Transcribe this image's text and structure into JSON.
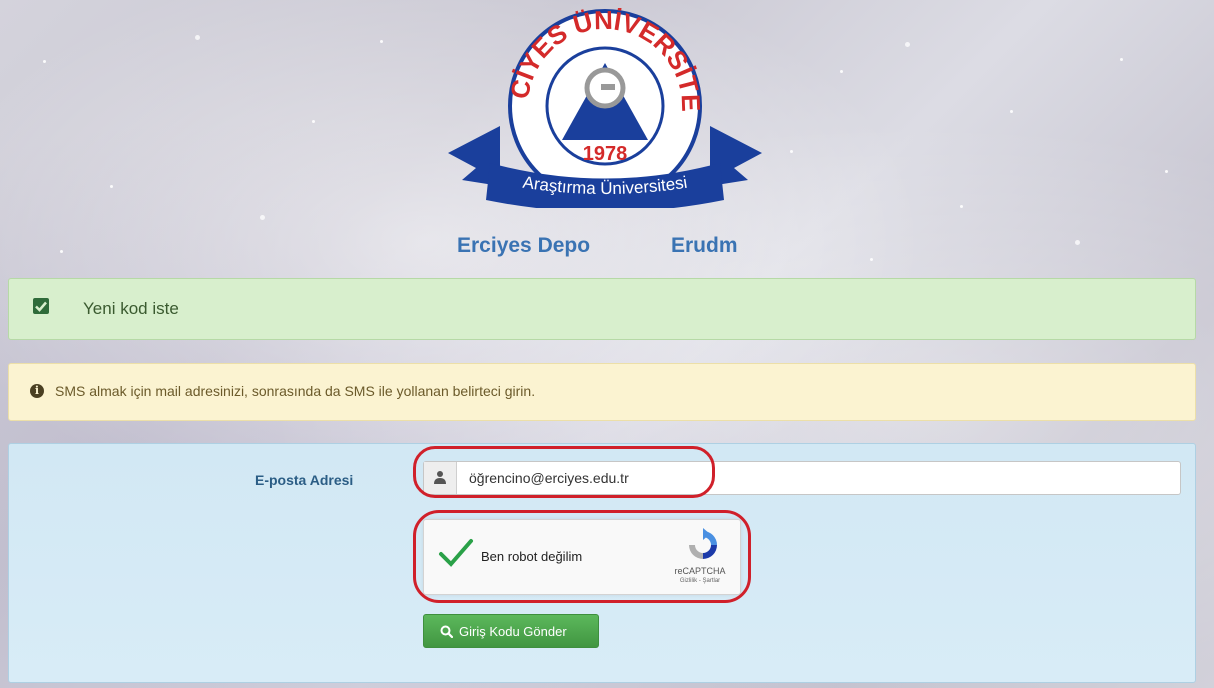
{
  "logo": {
    "arc_text": "ERCİYES ÜNİVERSİTESİ",
    "year": "1978",
    "banner_text": "Araştırma Üniversitesi",
    "colors": {
      "blue": "#1a3f9c",
      "red": "#d42a2a"
    }
  },
  "links": {
    "depo": "Erciyes Depo",
    "erudm": "Erudm"
  },
  "alert_success": {
    "label": "Yeni kod iste",
    "icon": "checkbox-checked-icon"
  },
  "alert_info": {
    "message": "SMS almak için mail adresinizi, sonrasında da SMS ile yollanan belirteci girin.",
    "icon": "info-circle-icon"
  },
  "form": {
    "email_label": "E-posta Adresi",
    "email_value": "öğrencino@erciyes.edu.tr",
    "email_icon": "user-icon",
    "submit_label": "Giriş Kodu Gönder",
    "submit_icon": "search-icon"
  },
  "recaptcha": {
    "label": "Ben robot değilim",
    "checked": true,
    "brand": "reCAPTCHA",
    "terms": "Gizlilik - Şartlar"
  },
  "colors": {
    "link": "#3a73b3",
    "success_bg": "#d8efcd",
    "warning_bg": "#fbf3d1",
    "panel_bg": "#d2e8f4",
    "button": "#5cb85c",
    "highlight": "#d0202a"
  }
}
